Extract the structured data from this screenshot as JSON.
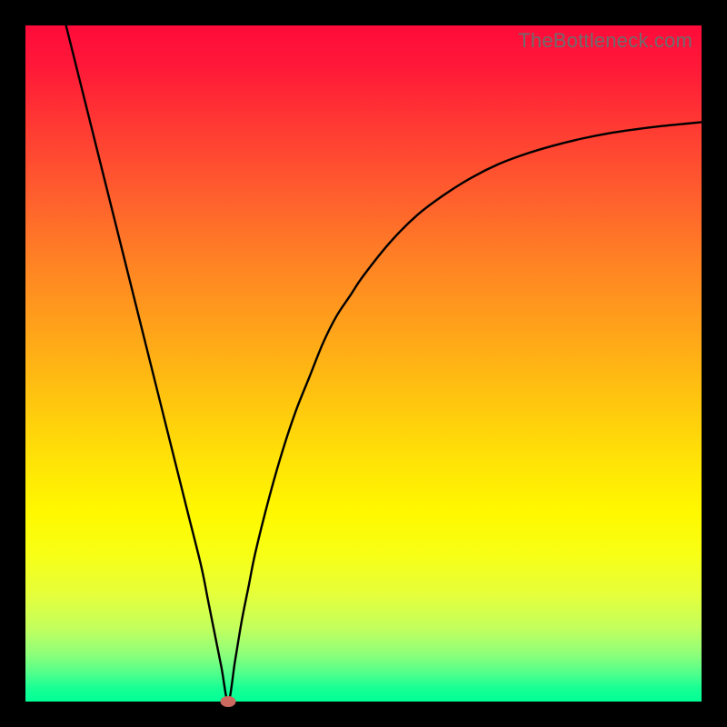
{
  "watermark": "TheBottleneck.com",
  "colors": {
    "frame": "#000000",
    "curve": "#000000",
    "dot": "#cc6a5f",
    "gradient_stops": [
      "#ff0b3a",
      "#ff3a33",
      "#ff8224",
      "#ffc40f",
      "#fff800",
      "#c4ff5c",
      "#00ff96"
    ]
  },
  "chart_data": {
    "type": "line",
    "title": "",
    "xlabel": "",
    "ylabel": "",
    "xlim": [
      0,
      100
    ],
    "ylim": [
      0,
      100
    ],
    "annotations": [
      {
        "name": "minimum-dot",
        "x": 30,
        "y": 0
      }
    ],
    "series": [
      {
        "name": "bottleneck-curve",
        "x": [
          6,
          8,
          10,
          12,
          14,
          16,
          18,
          20,
          22,
          24,
          26,
          27,
          28,
          29,
          30,
          31,
          32,
          33,
          34,
          36,
          38,
          40,
          42,
          44,
          46,
          48,
          50,
          54,
          58,
          62,
          66,
          70,
          74,
          78,
          82,
          86,
          90,
          94,
          98,
          100
        ],
        "y": [
          100,
          92,
          84,
          76,
          68,
          60,
          52,
          44,
          36,
          28,
          20,
          15,
          10,
          5,
          0,
          6,
          12,
          17,
          22,
          30,
          37,
          43,
          48,
          53,
          57,
          60,
          63,
          68,
          72,
          75,
          77.5,
          79.5,
          81,
          82.2,
          83.2,
          84,
          84.6,
          85.1,
          85.5,
          85.7
        ]
      }
    ]
  }
}
